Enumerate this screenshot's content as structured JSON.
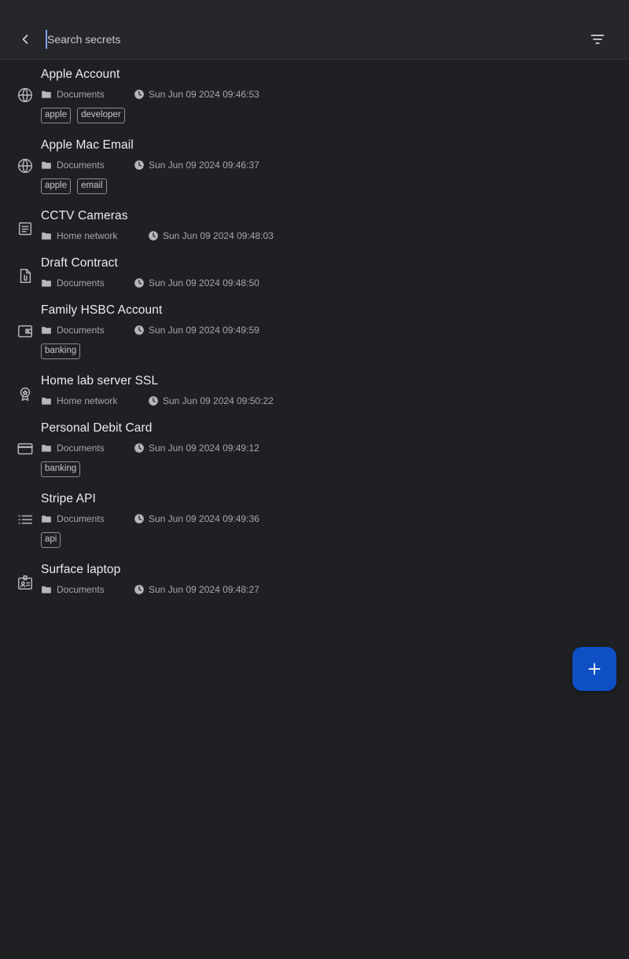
{
  "search": {
    "placeholder": "Search secrets",
    "value": ""
  },
  "fab": {
    "icon": "plus-icon"
  },
  "secrets": [
    {
      "icon": "globe-icon",
      "title": "Apple Account",
      "folder": "Documents",
      "date": "Sun Jun 09 2024 09:46:53",
      "tags": [
        "apple",
        "developer"
      ]
    },
    {
      "icon": "globe-icon",
      "title": "Apple Mac Email",
      "folder": "Documents",
      "date": "Sun Jun 09 2024 09:46:37",
      "tags": [
        "apple",
        "email"
      ]
    },
    {
      "icon": "note-icon",
      "title": "CCTV Cameras",
      "folder": "Home network",
      "date": "Sun Jun 09 2024 09:48:03",
      "tags": []
    },
    {
      "icon": "file-attachment-icon",
      "title": "Draft Contract",
      "folder": "Documents",
      "date": "Sun Jun 09 2024 09:48:50",
      "tags": []
    },
    {
      "icon": "wallet-icon",
      "title": "Family HSBC Account",
      "folder": "Documents",
      "date": "Sun Jun 09 2024 09:49:59",
      "tags": [
        "banking"
      ]
    },
    {
      "icon": "certificate-icon",
      "title": "Home lab server SSL",
      "folder": "Home network",
      "date": "Sun Jun 09 2024 09:50:22",
      "tags": []
    },
    {
      "icon": "credit-card-icon",
      "title": "Personal Debit Card",
      "folder": "Documents",
      "date": "Sun Jun 09 2024 09:49:12",
      "tags": [
        "banking"
      ]
    },
    {
      "icon": "list-icon",
      "title": "Stripe API",
      "folder": "Documents",
      "date": "Sun Jun 09 2024 09:49:36",
      "tags": [
        "api"
      ]
    },
    {
      "icon": "contact-card-icon",
      "title": "Surface laptop",
      "folder": "Documents",
      "date": "Sun Jun 09 2024 09:48:27",
      "tags": []
    }
  ]
}
